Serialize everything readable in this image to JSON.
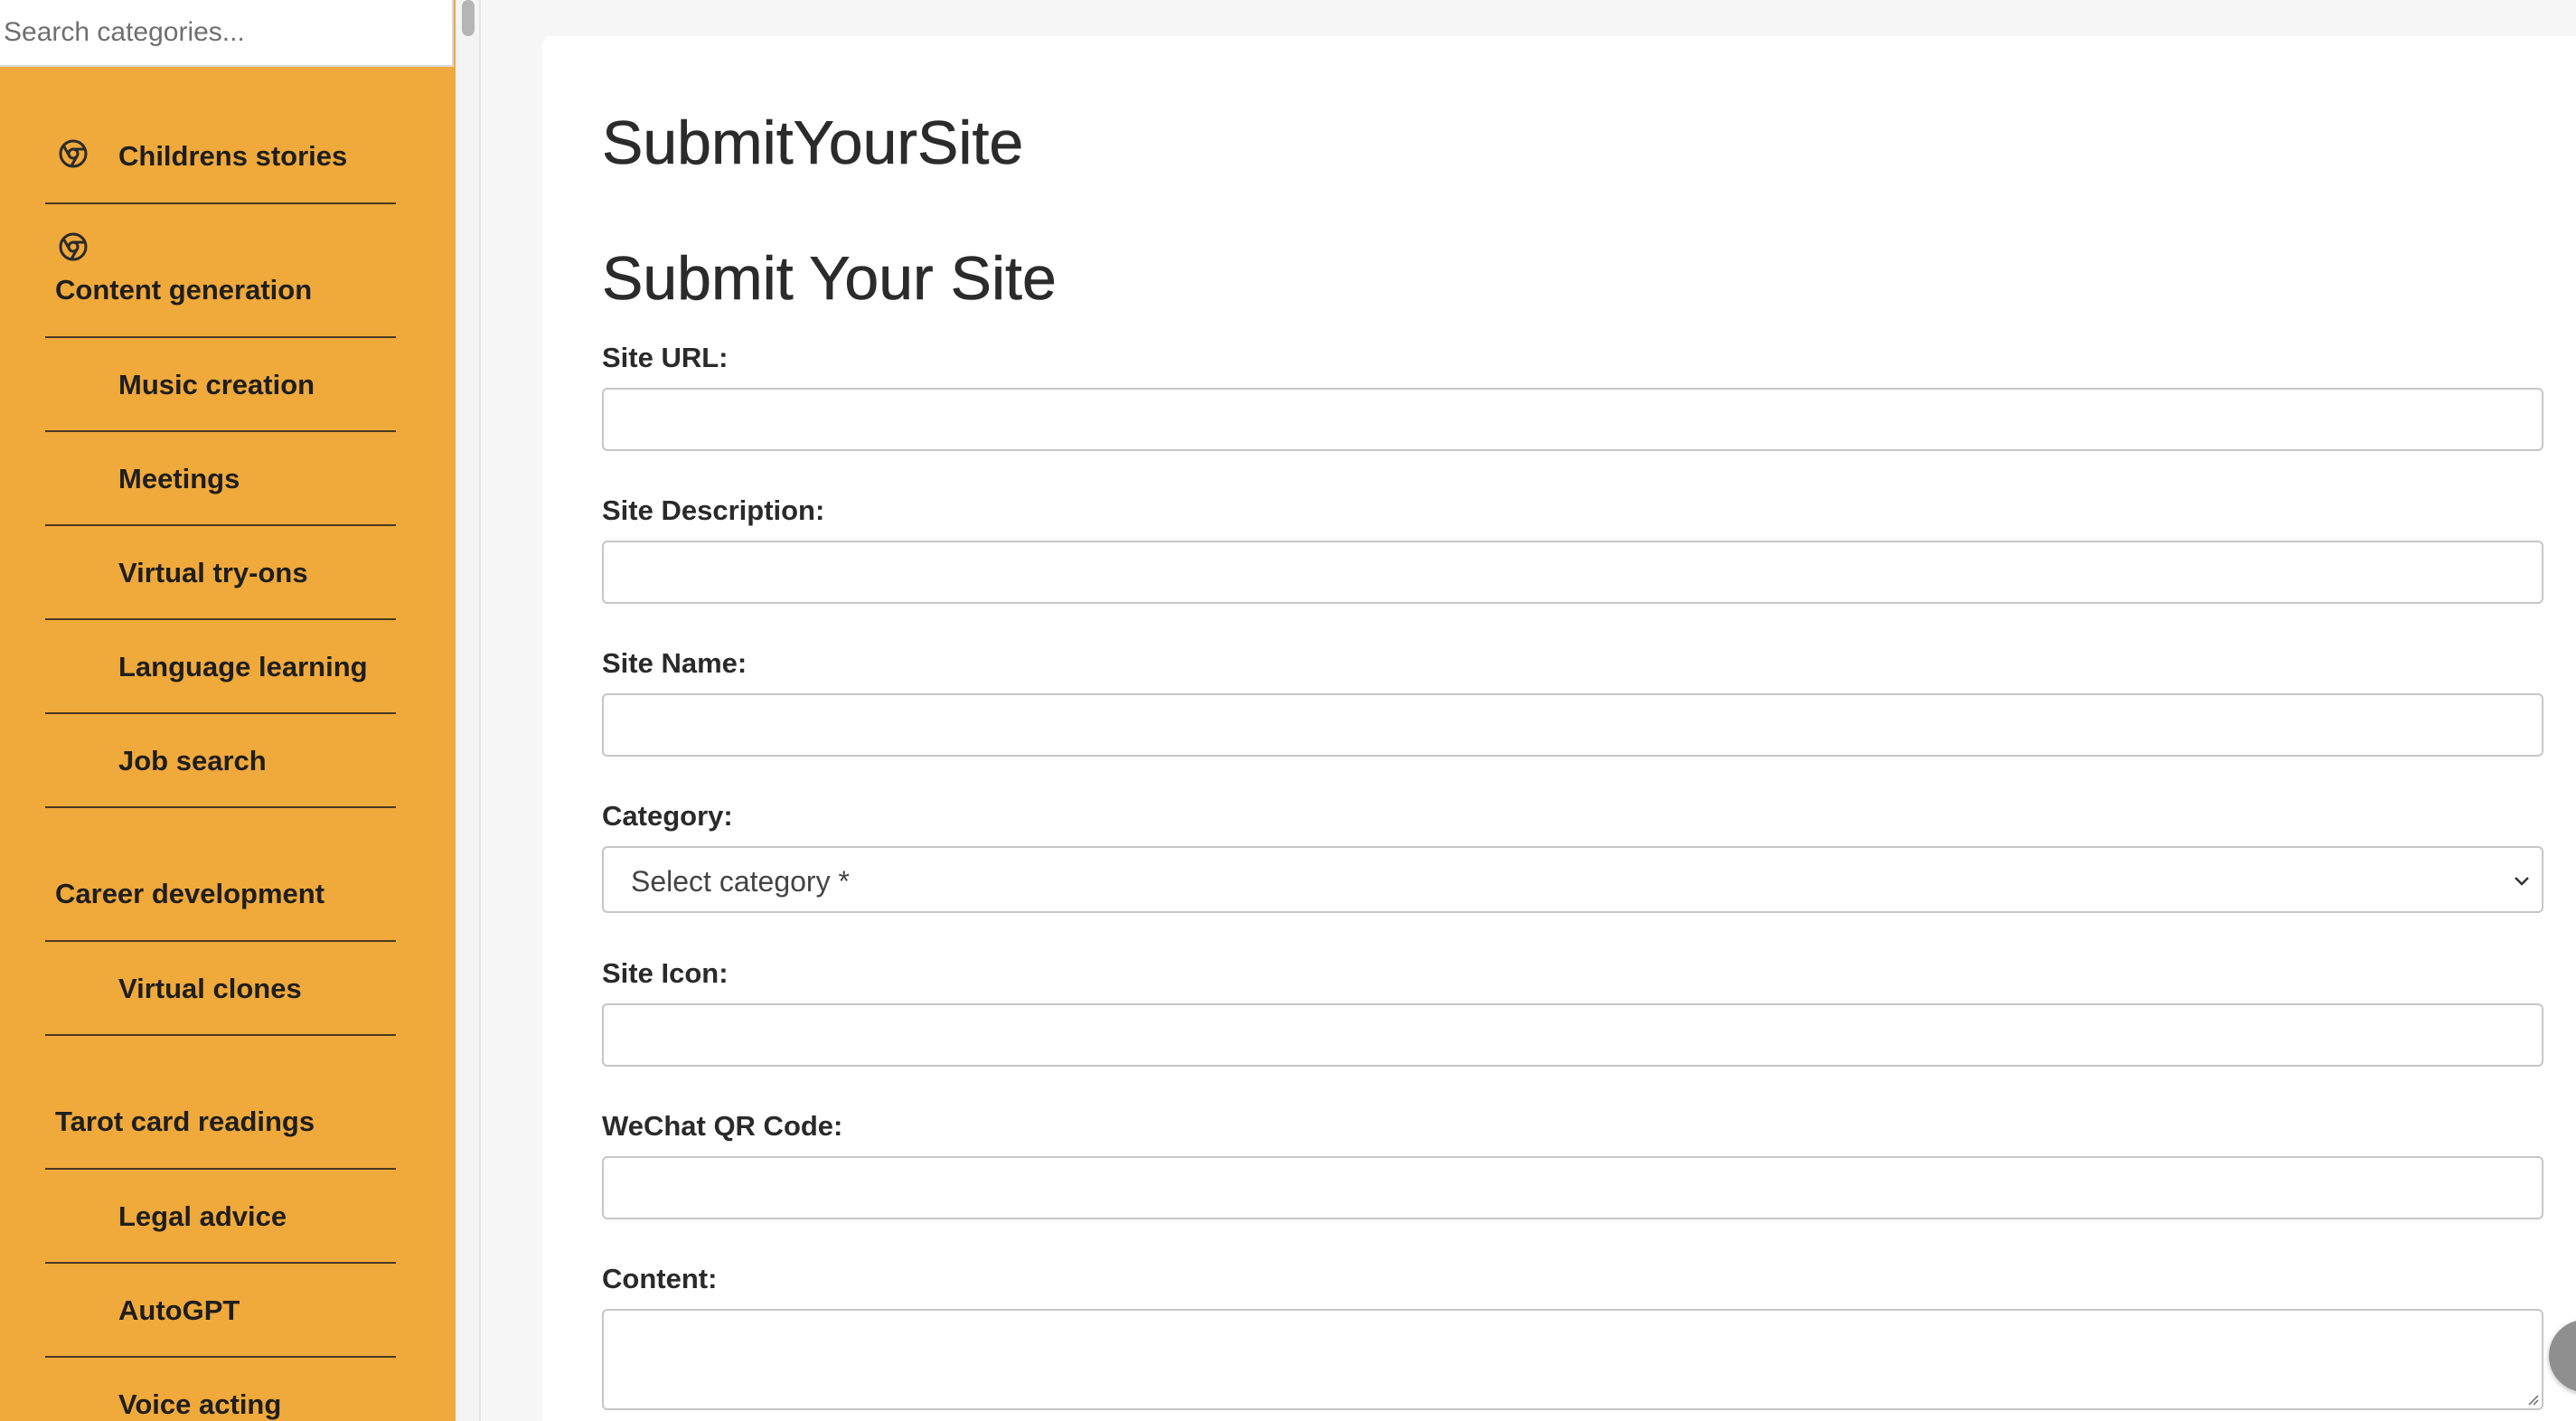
{
  "sidebar": {
    "search_placeholder": "Search categories...",
    "items": [
      {
        "label": "Childrens stories",
        "icon": "chrome-icon"
      },
      {
        "label": "Content generation",
        "icon": "chrome-icon"
      },
      {
        "label": "Music creation"
      },
      {
        "label": "Meetings"
      },
      {
        "label": "Virtual try-ons"
      },
      {
        "label": "Language learning"
      },
      {
        "label": "Job search"
      },
      {
        "label": "Career development"
      },
      {
        "label": "Virtual clones"
      },
      {
        "label": "Tarot card readings"
      },
      {
        "label": "Legal advice"
      },
      {
        "label": "AutoGPT"
      },
      {
        "label": "Voice acting"
      }
    ]
  },
  "main": {
    "site_title": "SubmitYourSite",
    "form_title": "Submit Your Site",
    "fields": {
      "url_label": "Site URL:",
      "description_label": "Site Description:",
      "name_label": "Site Name:",
      "category_label": "Category:",
      "category_value": "Select category *",
      "icon_label": "Site Icon:",
      "wechat_label": "WeChat QR Code:",
      "content_label": "Content:"
    }
  },
  "colors": {
    "sidebar_bg": "#f0a93b",
    "panel_bg": "#ffffff",
    "page_bg": "#f7f7f7"
  }
}
